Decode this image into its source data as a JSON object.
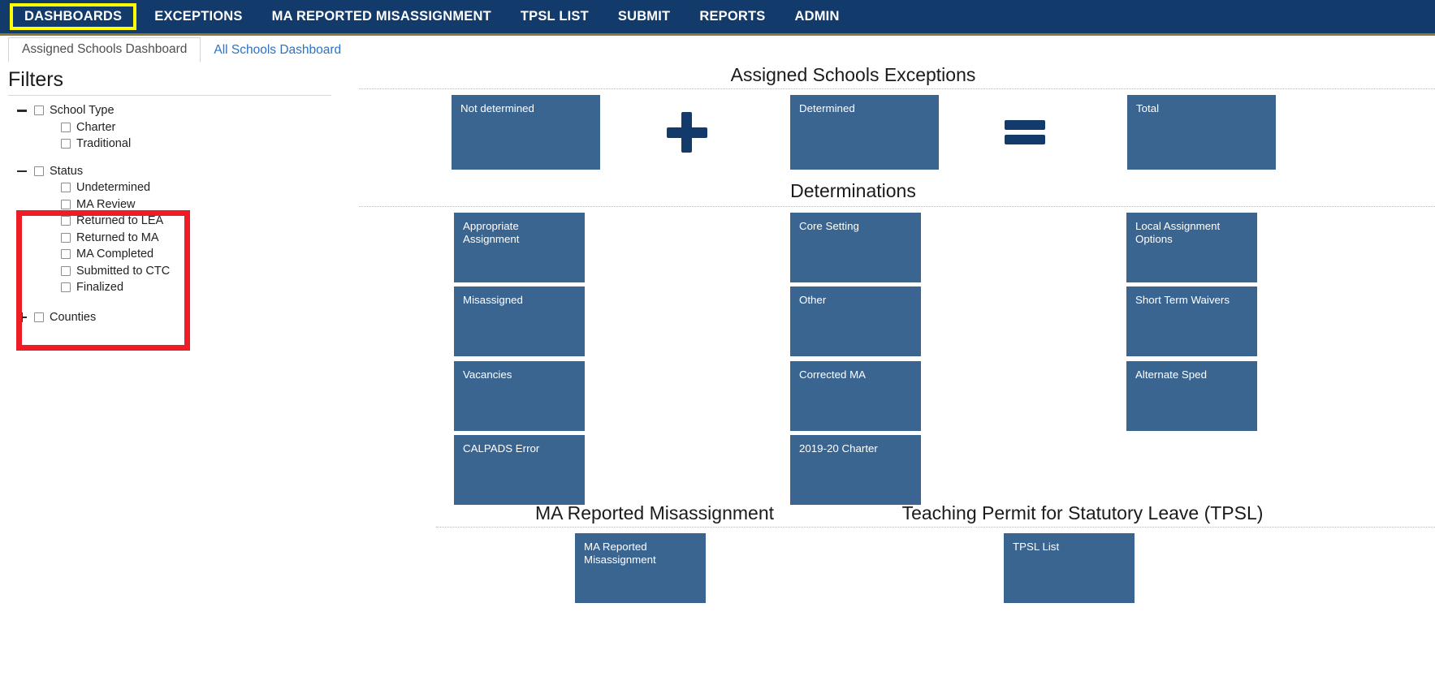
{
  "topnav": {
    "items": [
      {
        "label": "DASHBOARDS",
        "active": true
      },
      {
        "label": "EXCEPTIONS",
        "active": false
      },
      {
        "label": "MA REPORTED MISASSIGNMENT",
        "active": false
      },
      {
        "label": "TPSL LIST",
        "active": false
      },
      {
        "label": "SUBMIT",
        "active": false
      },
      {
        "label": "REPORTS",
        "active": false
      },
      {
        "label": "ADMIN",
        "active": false
      }
    ],
    "accent_highlight": "#ffff00",
    "background": "#123a6b"
  },
  "subtabs": [
    {
      "label": "Assigned Schools Dashboard",
      "selected": true
    },
    {
      "label": "All Schools Dashboard",
      "selected": false
    }
  ],
  "filters": {
    "title": "Filters",
    "highlight_color": "#ee1c25",
    "groups": [
      {
        "label": "School Type",
        "expander": "minus",
        "checked": false,
        "children": [
          {
            "label": "Charter",
            "checked": false
          },
          {
            "label": "Traditional",
            "checked": false
          }
        ]
      },
      {
        "label": "Status",
        "expander": "minus",
        "checked": false,
        "highlighted": true,
        "children": [
          {
            "label": "Undetermined",
            "checked": false
          },
          {
            "label": "MA Review",
            "checked": false
          },
          {
            "label": "Returned to LEA",
            "checked": false
          },
          {
            "label": "Returned to MA",
            "checked": false
          },
          {
            "label": "MA Completed",
            "checked": false
          },
          {
            "label": "Submitted to CTC",
            "checked": false
          },
          {
            "label": "Finalized",
            "checked": false
          }
        ]
      },
      {
        "label": "Counties",
        "expander": "plus",
        "checked": false,
        "children": []
      }
    ]
  },
  "dashboard": {
    "tile_color": "#3b6591",
    "sections": [
      {
        "id": "assigned-schools-exceptions",
        "title": "Assigned Schools Exceptions",
        "tiles": [
          {
            "label": "Not determined"
          },
          {
            "label": "Determined"
          },
          {
            "label": "Total"
          }
        ],
        "operators": [
          "plus",
          "equals"
        ]
      },
      {
        "id": "determinations",
        "title": "Determinations",
        "columns": [
          [
            "Appropriate Assignment",
            "Misassigned",
            "Vacancies",
            "CALPADS Error"
          ],
          [
            "Core Setting",
            "Other",
            "Corrected MA",
            "2019-20 Charter"
          ],
          [
            "Local Assignment Options",
            "Short Term Waivers",
            "Alternate Sped"
          ]
        ]
      },
      {
        "id": "ma-reported-misassignment",
        "title": "MA Reported Misassignment",
        "tiles": [
          {
            "label": "MA Reported Misassignment"
          }
        ]
      },
      {
        "id": "tpsl",
        "title": "Teaching Permit for Statutory Leave (TPSL)",
        "tiles": [
          {
            "label": "TPSL List"
          }
        ]
      }
    ]
  }
}
